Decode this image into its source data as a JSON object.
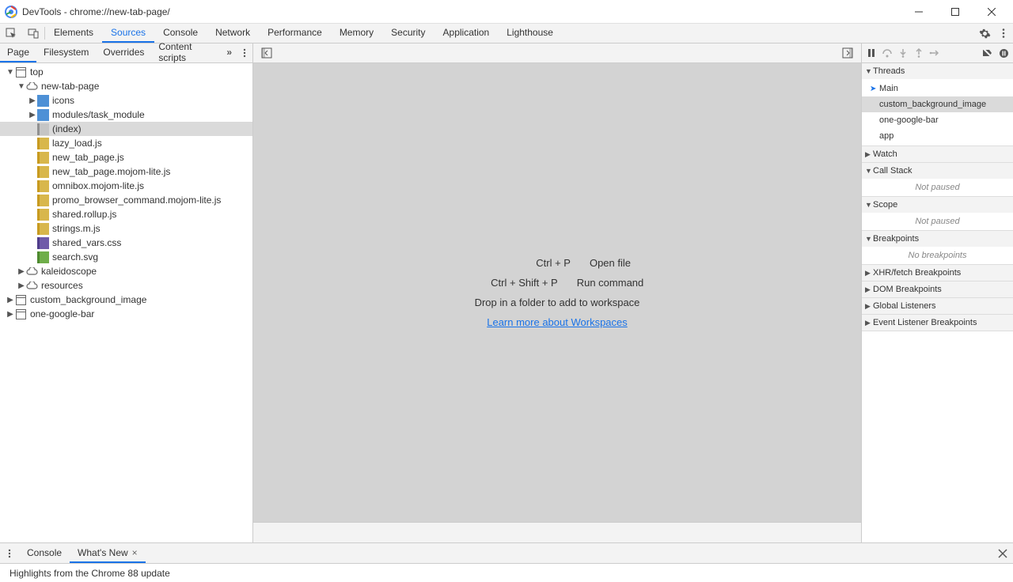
{
  "titlebar": {
    "title": "DevTools - chrome://new-tab-page/"
  },
  "mainTabs": [
    {
      "label": "Elements",
      "active": false
    },
    {
      "label": "Sources",
      "active": true
    },
    {
      "label": "Console",
      "active": false
    },
    {
      "label": "Network",
      "active": false
    },
    {
      "label": "Performance",
      "active": false
    },
    {
      "label": "Memory",
      "active": false
    },
    {
      "label": "Security",
      "active": false
    },
    {
      "label": "Application",
      "active": false
    },
    {
      "label": "Lighthouse",
      "active": false
    }
  ],
  "sourceSubTabs": [
    {
      "label": "Page",
      "active": true
    },
    {
      "label": "Filesystem",
      "active": false
    },
    {
      "label": "Overrides",
      "active": false
    },
    {
      "label": "Content scripts",
      "active": false
    }
  ],
  "tree": [
    {
      "depth": 0,
      "arrow": "down",
      "icon": "window",
      "label": "top"
    },
    {
      "depth": 1,
      "arrow": "down",
      "icon": "cloud",
      "label": "new-tab-page"
    },
    {
      "depth": 2,
      "arrow": "right",
      "icon": "folder",
      "label": "icons"
    },
    {
      "depth": 2,
      "arrow": "right",
      "icon": "folder",
      "label": "modules/task_module"
    },
    {
      "depth": 2,
      "arrow": "",
      "icon": "file-plain",
      "label": "(index)",
      "selected": true
    },
    {
      "depth": 2,
      "arrow": "",
      "icon": "file-js",
      "label": "lazy_load.js"
    },
    {
      "depth": 2,
      "arrow": "",
      "icon": "file-js",
      "label": "new_tab_page.js"
    },
    {
      "depth": 2,
      "arrow": "",
      "icon": "file-js",
      "label": "new_tab_page.mojom-lite.js"
    },
    {
      "depth": 2,
      "arrow": "",
      "icon": "file-js",
      "label": "omnibox.mojom-lite.js"
    },
    {
      "depth": 2,
      "arrow": "",
      "icon": "file-js",
      "label": "promo_browser_command.mojom-lite.js"
    },
    {
      "depth": 2,
      "arrow": "",
      "icon": "file-js",
      "label": "shared.rollup.js"
    },
    {
      "depth": 2,
      "arrow": "",
      "icon": "file-js",
      "label": "strings.m.js"
    },
    {
      "depth": 2,
      "arrow": "",
      "icon": "file-css",
      "label": "shared_vars.css"
    },
    {
      "depth": 2,
      "arrow": "",
      "icon": "file-svg",
      "label": "search.svg"
    },
    {
      "depth": 1,
      "arrow": "right",
      "icon": "cloud",
      "label": "kaleidoscope"
    },
    {
      "depth": 1,
      "arrow": "right",
      "icon": "cloud",
      "label": "resources"
    },
    {
      "depth": 0,
      "arrow": "right",
      "icon": "window",
      "label": "custom_background_image"
    },
    {
      "depth": 0,
      "arrow": "right",
      "icon": "window",
      "label": "one-google-bar"
    }
  ],
  "editor": {
    "openFileKey": "Ctrl + P",
    "openFileLabel": "Open file",
    "runCmdKey": "Ctrl + Shift + P",
    "runCmdLabel": "Run command",
    "dropHint": "Drop in a folder to add to workspace",
    "learnMore": "Learn more about Workspaces"
  },
  "debugSections": {
    "threads": {
      "label": "Threads",
      "expanded": true,
      "items": [
        {
          "label": "Main",
          "current": true
        },
        {
          "label": "custom_background_image",
          "selected": true
        },
        {
          "label": "one-google-bar"
        },
        {
          "label": "app"
        }
      ]
    },
    "watch": {
      "label": "Watch",
      "expanded": false
    },
    "callStack": {
      "label": "Call Stack",
      "expanded": true,
      "empty": "Not paused"
    },
    "scope": {
      "label": "Scope",
      "expanded": true,
      "empty": "Not paused"
    },
    "breakpoints": {
      "label": "Breakpoints",
      "expanded": true,
      "empty": "No breakpoints"
    },
    "xhr": {
      "label": "XHR/fetch Breakpoints",
      "expanded": false
    },
    "dom": {
      "label": "DOM Breakpoints",
      "expanded": false
    },
    "globalListeners": {
      "label": "Global Listeners",
      "expanded": false
    },
    "eventListeners": {
      "label": "Event Listener Breakpoints",
      "expanded": false
    }
  },
  "drawer": {
    "tabs": [
      {
        "label": "Console",
        "active": false
      },
      {
        "label": "What's New",
        "active": true,
        "closable": true
      }
    ],
    "body": "Highlights from the Chrome 88 update"
  }
}
